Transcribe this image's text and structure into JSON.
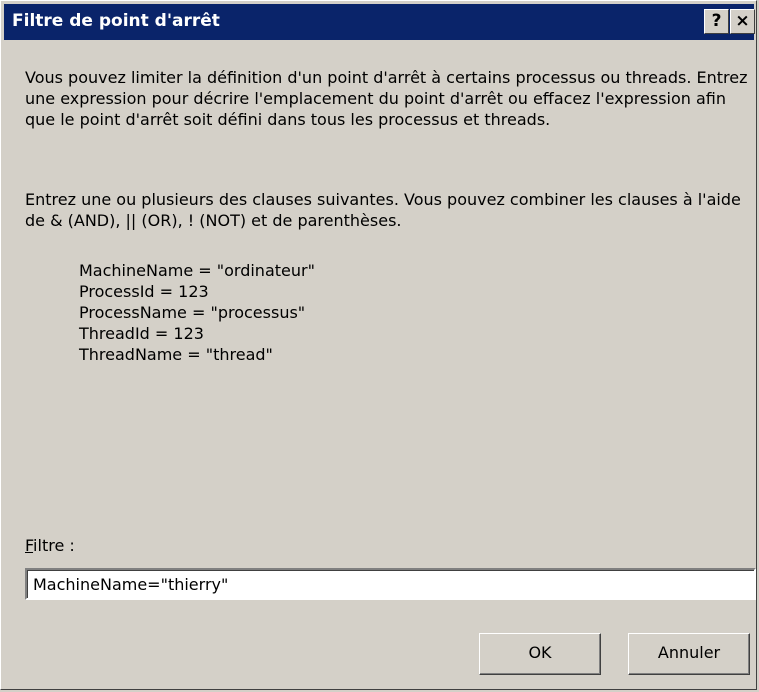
{
  "window": {
    "title": "Filtre de point d'arrêt",
    "help_glyph": "?",
    "close_glyph": "×"
  },
  "body": {
    "paragraph1": "Vous pouvez limiter la définition d'un point d'arrêt à certains processus ou threads. Entrez une expression pour décrire l'emplacement du point d'arrêt ou effacez l'expression afin que le point d'arrêt soit défini dans tous les processus et threads.",
    "paragraph2": "Entrez une ou plusieurs des clauses suivantes. Vous pouvez combiner les clauses à l'aide de & (AND), || (OR), ! (NOT) et de parenthèses.",
    "clauses": [
      "MachineName = \"ordinateur\"",
      "ProcessId = 123",
      "ProcessName = \"processus\"",
      "ThreadId = 123",
      "ThreadName = \"thread\""
    ]
  },
  "filter": {
    "label_accel": "F",
    "label_rest": "iltre :",
    "value": "MachineName=\"thierry\""
  },
  "buttons": {
    "ok": "OK",
    "cancel": "Annuler"
  }
}
